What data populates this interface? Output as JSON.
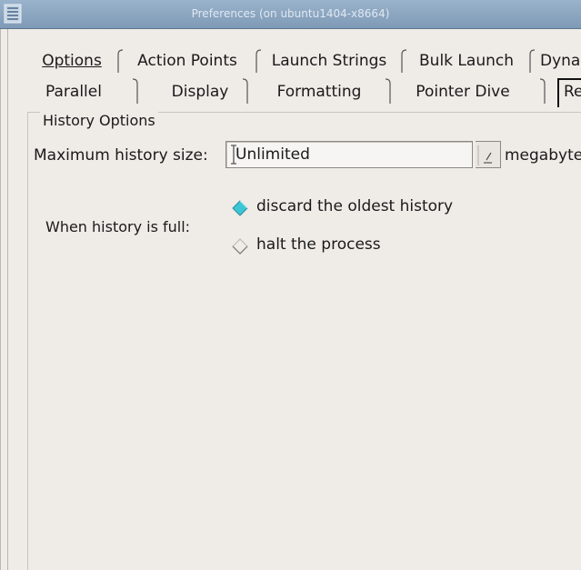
{
  "window": {
    "title": "Preferences (on ubuntu1404-x8664)",
    "titlebar_color": "#8aa3bd"
  },
  "tabs": {
    "row1": [
      {
        "label": "Options",
        "mnemonic": "O"
      },
      {
        "label": "Action Points",
        "mnemonic": "A"
      },
      {
        "label": "Launch Strings",
        "mnemonic": "L"
      },
      {
        "label": "Bulk Launch",
        "mnemonic": "B"
      },
      {
        "label": "Dyna",
        "mnemonic": "D"
      }
    ],
    "row2": [
      {
        "label": "Parallel",
        "mnemonic": "P"
      },
      {
        "label": "Display",
        "mnemonic": "p"
      },
      {
        "label": "Formatting",
        "mnemonic": "F"
      },
      {
        "label": "Pointer Dive",
        "mnemonic": "i"
      },
      {
        "label": "Re",
        "mnemonic": "R",
        "active": true
      }
    ]
  },
  "history_options": {
    "group_title": "History Options",
    "max_size_label": "Maximum history size:",
    "max_size_value": "Unlimited",
    "units_label": "megabyte",
    "when_full_label": "When history is full:",
    "options": [
      {
        "label": "discard the oldest history",
        "selected": true
      },
      {
        "label": "halt the process",
        "selected": false
      }
    ]
  },
  "colors": {
    "radio_selected": "#3bc6d6",
    "background": "#efebe7"
  }
}
